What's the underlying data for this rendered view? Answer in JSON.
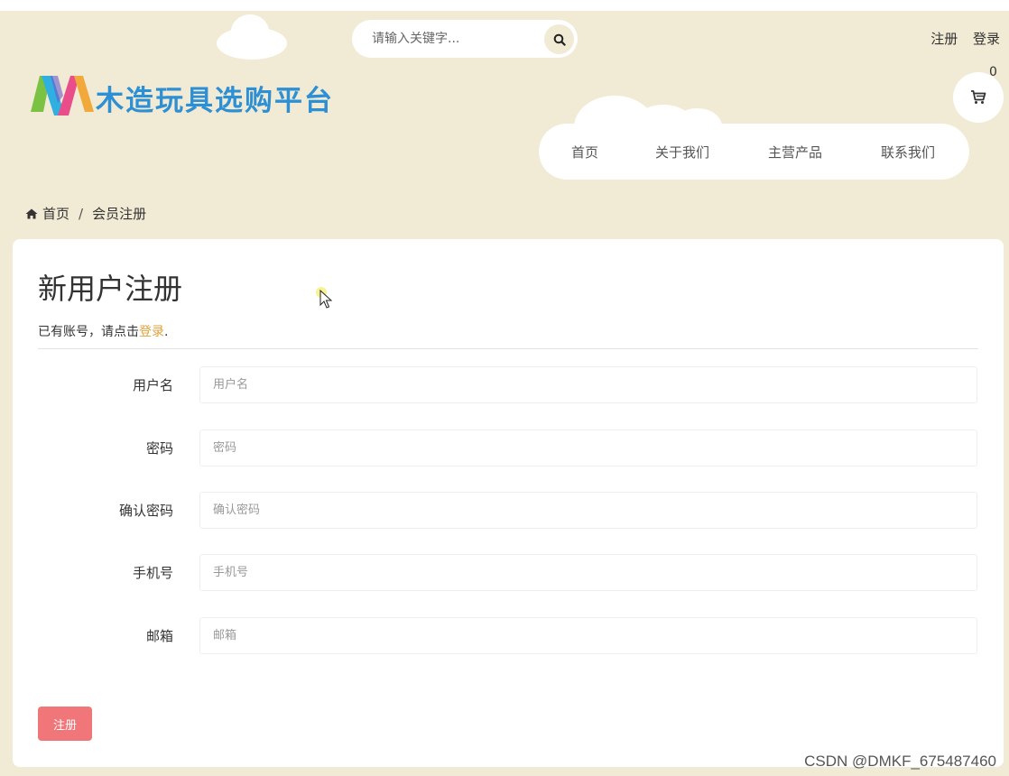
{
  "search": {
    "placeholder": "请输入关键字..."
  },
  "top_links": {
    "register": "注册",
    "login": "登录"
  },
  "logo": {
    "text": "木造玩具选购平台"
  },
  "cart": {
    "count": "0"
  },
  "nav": {
    "items": [
      "首页",
      "关于我们",
      "主营产品",
      "联系我们"
    ]
  },
  "breadcrumb": {
    "home": "首页",
    "separator": "/",
    "current": "会员注册"
  },
  "form": {
    "title": "新用户注册",
    "subtext_prefix": "已有账号，请点击",
    "login_link": "登录",
    "subtext_suffix": ".",
    "fields": [
      {
        "label": "用户名",
        "placeholder": "用户名"
      },
      {
        "label": "密码",
        "placeholder": "密码"
      },
      {
        "label": "确认密码",
        "placeholder": "确认密码"
      },
      {
        "label": "手机号",
        "placeholder": "手机号"
      },
      {
        "label": "邮箱",
        "placeholder": "邮箱"
      }
    ],
    "submit_label": "注册"
  },
  "watermark": "CSDN @DMKF_675487460",
  "colors": {
    "background": "#f1ead4",
    "accent_link": "#e0a13a",
    "submit": "#f0767a",
    "logo_text": "#2d8fd4"
  }
}
